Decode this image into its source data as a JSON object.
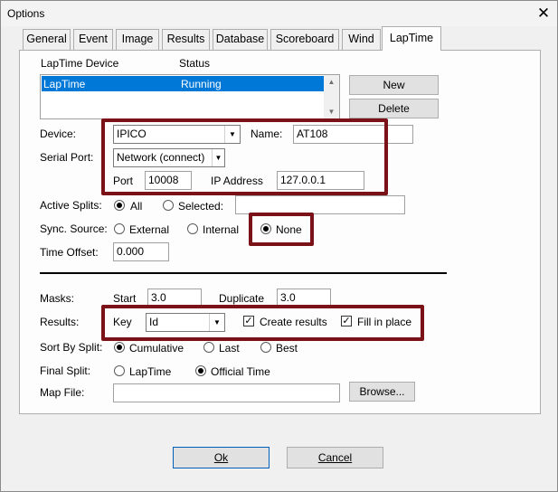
{
  "window": {
    "title": "Options",
    "close_glyph": "✕"
  },
  "tabs": [
    "General",
    "Event",
    "Image",
    "Results",
    "Database",
    "Scoreboard",
    "Wind",
    "LapTime"
  ],
  "device_list": {
    "col_device": "LapTime Device",
    "col_status": "Status",
    "rows": [
      {
        "device": "LapTime",
        "status": "Running"
      }
    ]
  },
  "buttons": {
    "new": "New",
    "delete": "Delete",
    "browse": "Browse...",
    "ok": "Ok",
    "cancel": "Cancel"
  },
  "device": {
    "label": "Device:",
    "value": "IPICO",
    "name_label": "Name:",
    "name_value": "AT108"
  },
  "serial": {
    "label": "Serial Port:",
    "value": "Network (connect)",
    "port_label": "Port",
    "port_value": "10008",
    "ip_label": "IP Address",
    "ip_value": "127.0.0.1"
  },
  "active_splits": {
    "label": "Active Splits:",
    "all": "All",
    "selected": "Selected:",
    "selected_value": ""
  },
  "sync": {
    "label": "Sync. Source:",
    "external": "External",
    "internal": "Internal",
    "none": "None"
  },
  "time_offset": {
    "label": "Time Offset:",
    "value": "0.000"
  },
  "masks": {
    "label": "Masks:",
    "start_label": "Start",
    "start_value": "3.0",
    "duplicate_label": "Duplicate",
    "duplicate_value": "3.0"
  },
  "results": {
    "label": "Results:",
    "key_label": "Key",
    "key_value": "Id",
    "create": "Create results",
    "fill": "Fill in place"
  },
  "sort_by_split": {
    "label": "Sort By Split:",
    "cumulative": "Cumulative",
    "last": "Last",
    "best": "Best"
  },
  "final_split": {
    "label": "Final Split:",
    "laptime": "LapTime",
    "official": "Official Time"
  },
  "map_file": {
    "label": "Map File:",
    "value": ""
  },
  "colors": {
    "highlight": "#7a1217",
    "selection": "#0078d7"
  }
}
